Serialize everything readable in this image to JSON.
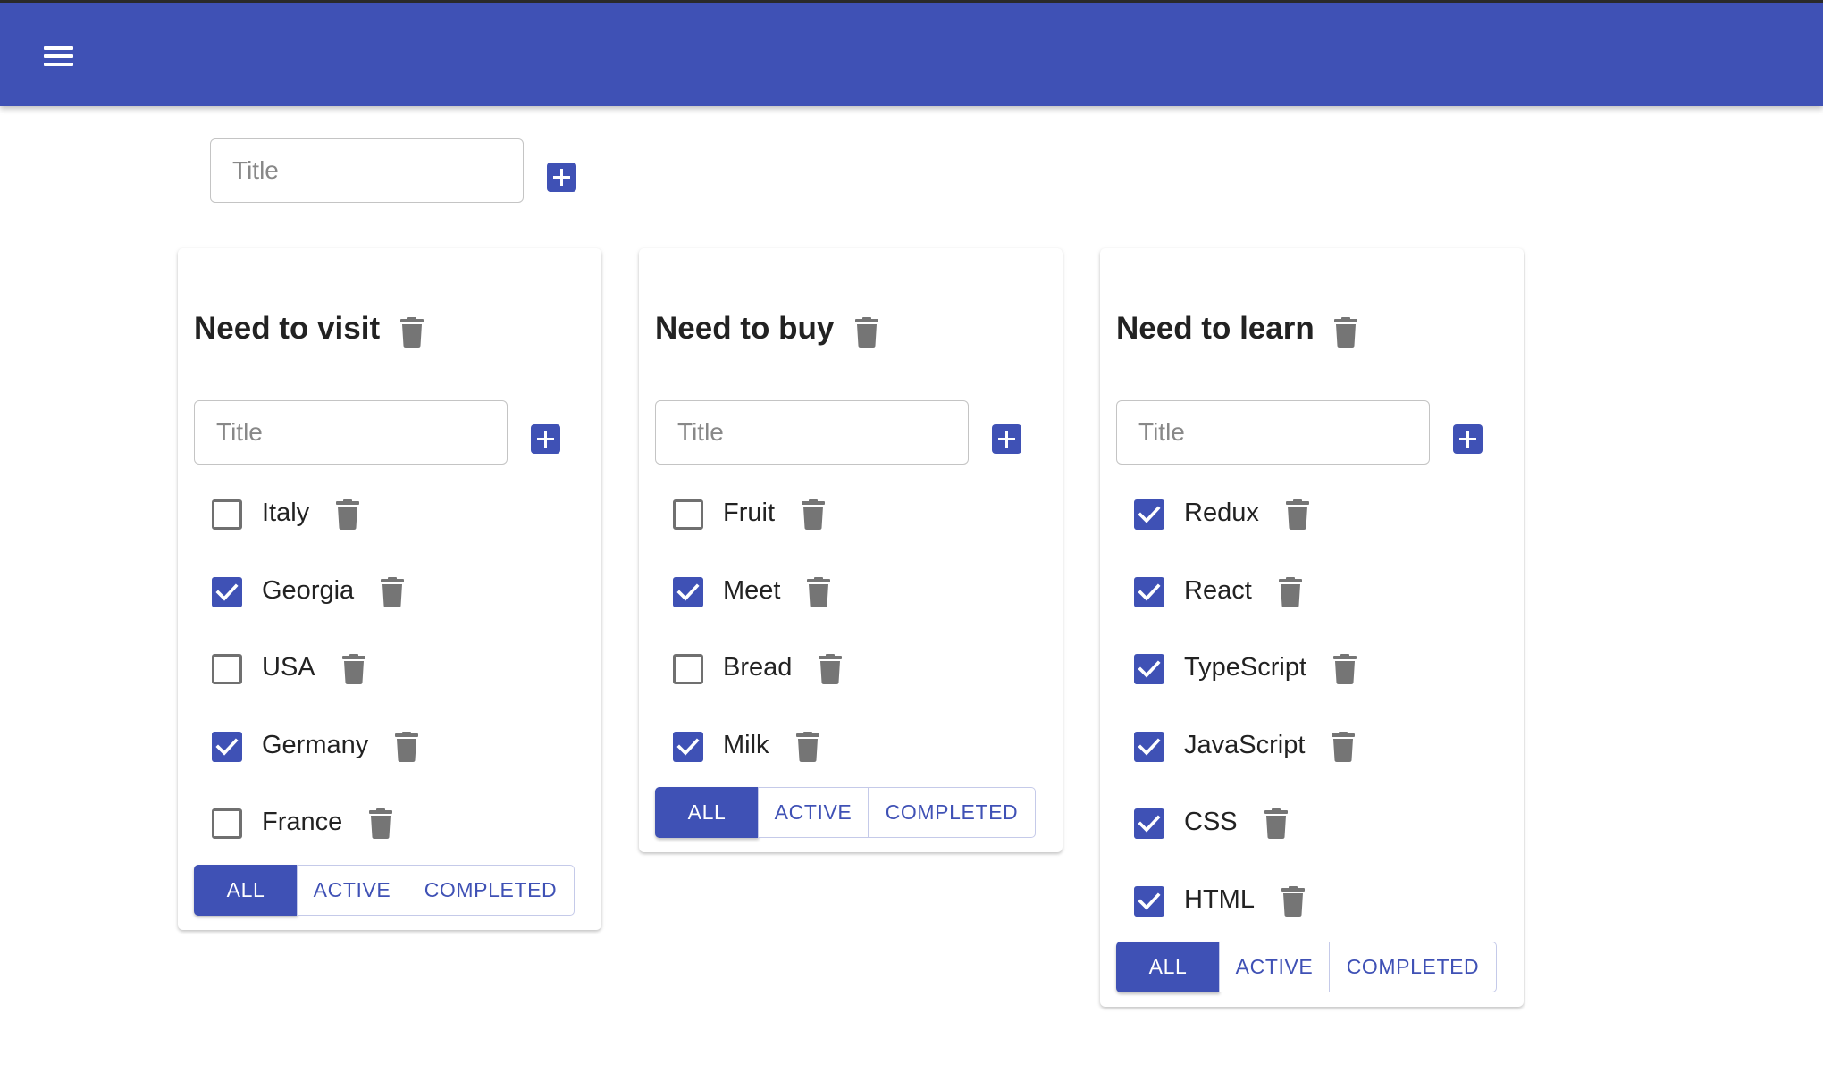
{
  "header": {
    "menu_icon": "menu-icon",
    "color": "#3f51b5"
  },
  "new_list": {
    "placeholder": "Title"
  },
  "filters": {
    "all": "ALL",
    "active": "ACTIVE",
    "completed": "COMPLETED"
  },
  "lists": [
    {
      "title": "Need to visit",
      "placeholder": "Title",
      "active_filter": "all",
      "items": [
        {
          "label": "Italy",
          "checked": false
        },
        {
          "label": "Georgia",
          "checked": true
        },
        {
          "label": "USA",
          "checked": false
        },
        {
          "label": "Germany",
          "checked": true
        },
        {
          "label": "France",
          "checked": false
        }
      ]
    },
    {
      "title": "Need to buy",
      "placeholder": "Title",
      "active_filter": "all",
      "items": [
        {
          "label": "Fruit",
          "checked": false
        },
        {
          "label": "Meet",
          "checked": true
        },
        {
          "label": "Bread",
          "checked": false
        },
        {
          "label": "Milk",
          "checked": true
        }
      ]
    },
    {
      "title": "Need to learn",
      "placeholder": "Title",
      "active_filter": "all",
      "items": [
        {
          "label": "Redux",
          "checked": true
        },
        {
          "label": "React",
          "checked": true
        },
        {
          "label": "TypeScript",
          "checked": true
        },
        {
          "label": "JavaScript",
          "checked": true
        },
        {
          "label": "CSS",
          "checked": true
        },
        {
          "label": "HTML",
          "checked": true
        }
      ]
    }
  ]
}
